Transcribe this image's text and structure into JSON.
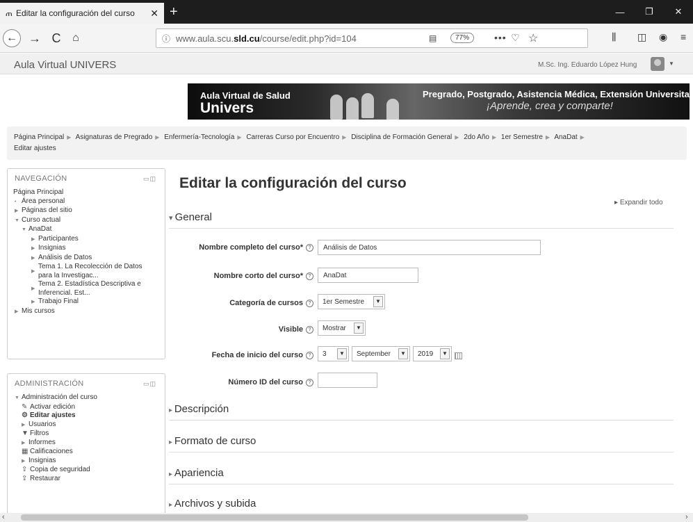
{
  "browser": {
    "tab_title": "Editar la configuración del curso",
    "tab_favicon": "moodle-favicon",
    "url_prefix": "www.aula.scu.",
    "url_domain": "sld.cu",
    "url_path": "/course/edit.php?id=104",
    "zoom": "77%"
  },
  "header": {
    "site_name": "Aula Virtual UNIVERS",
    "user_name": "M.Sc. Ing. Eduardo López Hung"
  },
  "banner": {
    "line1": "Aula Virtual de Salud",
    "line2": "Univers",
    "line3": "Pregrado, Postgrado, Asistencia Médica, Extensión Universitaria",
    "line4": "¡Aprende, crea y comparte!"
  },
  "breadcrumb": [
    "Página Principal",
    "Asignaturas de Pregrado",
    "Enfermería-Tecnología",
    "Carreras Curso por Encuentro",
    "Disciplina de Formación General",
    "2do Año",
    "1er Semestre",
    "AnaDat",
    "Editar ajustes"
  ],
  "navigation": {
    "title": "NAVEGACIÓN",
    "items": [
      {
        "label": "Página Principal",
        "mark": ""
      },
      {
        "label": "Área personal",
        "mark": "•"
      },
      {
        "label": "Páginas del sitio",
        "mark": "▶"
      },
      {
        "label": "Curso actual",
        "mark": "▼"
      },
      {
        "label": "AnaDat",
        "mark": "▼"
      },
      {
        "label": "Participantes",
        "mark": "▶"
      },
      {
        "label": "Insignias",
        "mark": "▶"
      },
      {
        "label": "Análisis de Datos",
        "mark": "▶"
      },
      {
        "label": "Tema 1. La Recolección de Datos para la Investigac...",
        "mark": "▶"
      },
      {
        "label": "Tema 2. Estadística Descriptiva e Inferencial. Est...",
        "mark": "▶"
      },
      {
        "label": "Trabajo Final",
        "mark": "▶"
      },
      {
        "label": "Mis cursos",
        "mark": "▶"
      }
    ]
  },
  "administration": {
    "title": "ADMINISTRACIÓN",
    "items": [
      {
        "label": "Administración del curso",
        "icon": "▼"
      },
      {
        "label": "Activar edición",
        "icon": "✎"
      },
      {
        "label": "Editar ajustes",
        "icon": "⚙"
      },
      {
        "label": "Usuarios",
        "icon": "▶"
      },
      {
        "label": "Filtros",
        "icon": "▼"
      },
      {
        "label": "Informes",
        "icon": "▶"
      },
      {
        "label": "Calificaciones",
        "icon": "▦"
      },
      {
        "label": "Insignias",
        "icon": "▶"
      },
      {
        "label": "Copia de seguridad",
        "icon": "⇪"
      },
      {
        "label": "Restaurar",
        "icon": "⇪"
      }
    ]
  },
  "main": {
    "title": "Editar la configuración del curso",
    "expand_all": "Expandir todo",
    "section_general": "General",
    "fields": {
      "fullname_label": "Nombre completo del curso*",
      "fullname_value": "Análisis de Datos",
      "shortname_label": "Nombre corto del curso*",
      "shortname_value": "AnaDat",
      "category_label": "Categoría de cursos",
      "category_value": "1er Semestre",
      "visible_label": "Visible",
      "visible_value": "Mostrar",
      "startdate_label": "Fecha de inicio del curso",
      "start_day": "3",
      "start_month": "September",
      "start_year": "2019",
      "idnumber_label": "Número ID del curso",
      "idnumber_value": ""
    },
    "sections": [
      "Descripción",
      "Formato de curso",
      "Apariencia",
      "Archivos y subida"
    ]
  }
}
